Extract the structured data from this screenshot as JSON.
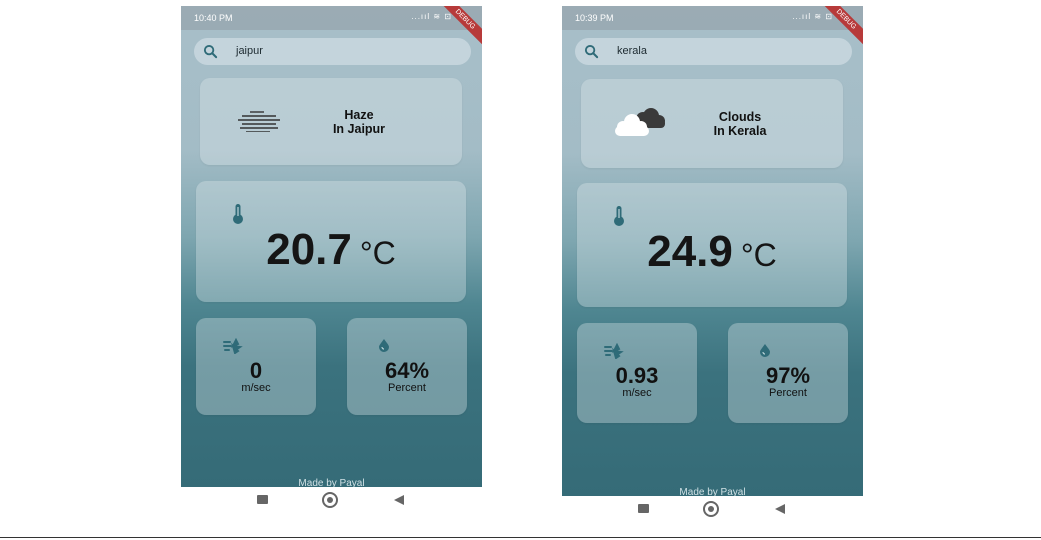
{
  "screens": [
    {
      "status_time": "10:40 PM",
      "status_icons": "...ııl ≋ ⊡",
      "debug_banner": "DEBUG",
      "search_value": "jaipur",
      "condition_line1": "Haze",
      "condition_line2": "In Jaipur",
      "condition_icon": "haze-icon",
      "temperature": "20.7",
      "temperature_unit": "°C",
      "wind_value": "0",
      "wind_unit": "m/sec",
      "humidity_value": "64%",
      "humidity_unit": "Percent",
      "footer": "Made by Payal"
    },
    {
      "status_time": "10:39 PM",
      "status_icons": "...ııl ≋ ⊡",
      "debug_banner": "DEBUG",
      "search_value": "kerala",
      "condition_line1": "Clouds",
      "condition_line2": "In Kerala",
      "condition_icon": "clouds-icon",
      "temperature": "24.9",
      "temperature_unit": "°C",
      "wind_value": "0.93",
      "wind_unit": "m/sec",
      "humidity_value": "97%",
      "humidity_unit": "Percent",
      "footer": "Made by Payal"
    }
  ],
  "colors": {
    "gradient_top": "#a8bfc9",
    "gradient_bottom": "#356b77",
    "accent_icon": "#2f6b78",
    "debug_banner": "#b73a3a"
  }
}
